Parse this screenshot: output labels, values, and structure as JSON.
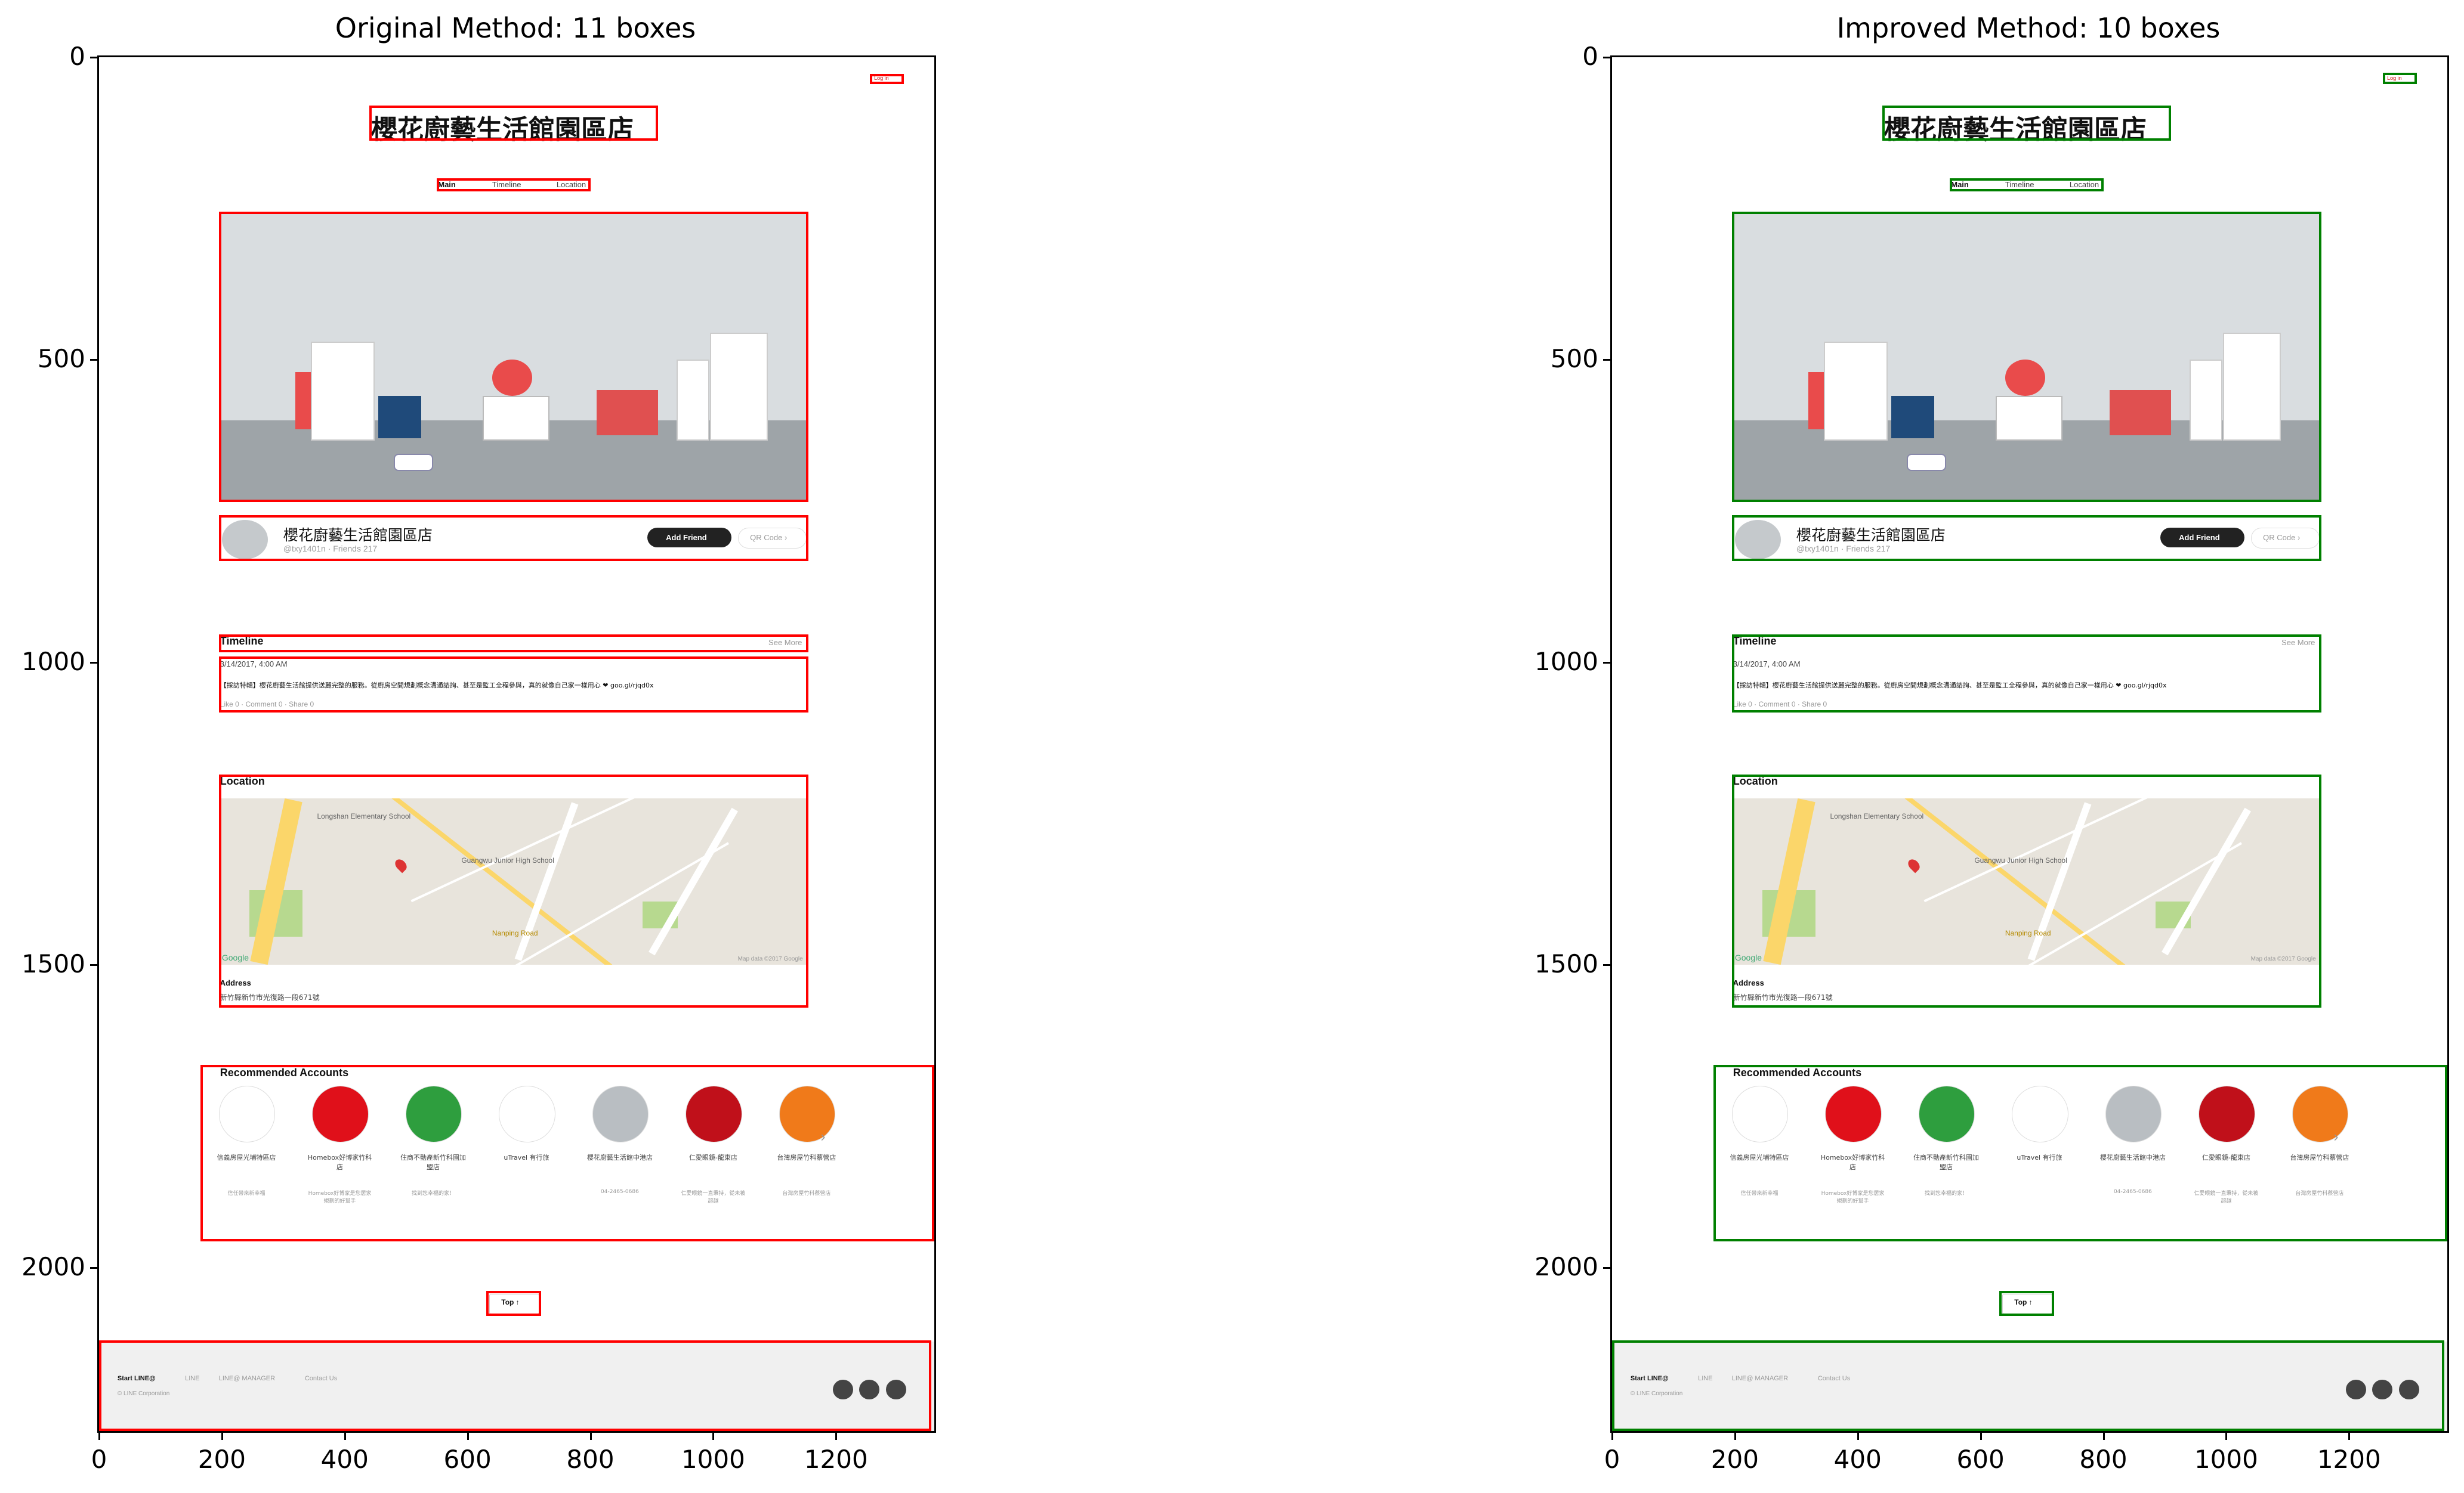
{
  "colors": {
    "original": "#ff0000",
    "improved": "#008000",
    "axis": "#000000"
  },
  "panels": [
    {
      "title": "Original Method: 11 boxes",
      "box_color": "red",
      "x_ticks": [
        "0",
        "200",
        "400",
        "600",
        "800",
        "1000",
        "1200"
      ],
      "y_ticks": [
        "0",
        "500",
        "1000",
        "1500",
        "2000"
      ]
    },
    {
      "title": "Improved Method: 10 boxes",
      "box_color": "green",
      "x_ticks": [
        "0",
        "200",
        "400",
        "600",
        "800",
        "1000",
        "1200"
      ],
      "y_ticks": [
        "0",
        "500",
        "1000",
        "1500",
        "2000"
      ]
    }
  ],
  "screenshot": {
    "login": "Log in",
    "page_title": "櫻花廚藝生活館園區店",
    "nav": [
      "Main",
      "Timeline",
      "Location"
    ],
    "account_name": "櫻花廚藝生活館園區店",
    "account_handle": "@txy1401n · Friends 217",
    "add_friend": "Add Friend",
    "qr_code": "QR Code ›",
    "timeline_heading": "Timeline",
    "see_more": "See More",
    "post_date": "3/14/2017, 4:00 AM",
    "post_text": "【採訪特輯】櫻花廚藝生活館提供送麗完整的服務。從廚房空間規劃概念溝通諮詢、甚至是監工全程參與，真的就像自己家一樣用心 ❤ goo.gl/rjqd0x",
    "post_stats": "Like 0 · Comment 0 · Share 0",
    "location_heading": "Location",
    "map_labels": [
      "Longshan Elementary School",
      "Guangwu Junior High School",
      "Nanping Road",
      "Google",
      "Map data ©2017 Google"
    ],
    "address_heading": "Address",
    "address": "新竹縣新竹市光復路一段671號",
    "recommended_heading": "Recommended Accounts",
    "recommended": [
      {
        "name": "信義房屋光埔特區店",
        "desc": "信任帶來新幸福"
      },
      {
        "name": "Homebox好博家竹科店",
        "desc": "Homebox好博家是您居家規劃的好幫手"
      },
      {
        "name": "住商不動產新竹科園加盟店",
        "desc": "找到您幸福的家！"
      },
      {
        "name": "uTravel 有行旅",
        "desc": ""
      },
      {
        "name": "櫻花廚藝生活館中港店",
        "desc": "04-2465-0686"
      },
      {
        "name": "仁愛眼鏡-龍東店",
        "desc": "仁愛眼鏡一直秉持，從未被超越"
      },
      {
        "name": "台灣房屋竹科蔡營店",
        "desc": "台灣房屋竹科蔡營店"
      }
    ],
    "top_button": "Top ↑",
    "footer_links": [
      "Start LINE@",
      "LINE",
      "LINE@ MANAGER",
      "Contact Us"
    ],
    "footer_copy": "© LINE Corporation"
  },
  "chart_data": [
    {
      "type": "image-with-boxes",
      "title": "Original Method: 11 boxes",
      "box_color": "red",
      "xlim": [
        0,
        1360
      ],
      "ylim": [
        2270,
        0
      ],
      "x_ticks": [
        0,
        200,
        400,
        600,
        800,
        1000,
        1200
      ],
      "y_ticks": [
        0,
        500,
        1000,
        1500,
        2000
      ],
      "boxes": [
        {
          "x0": 1255,
          "y0": 28,
          "x1": 1310,
          "y1": 44
        },
        {
          "x0": 440,
          "y0": 80,
          "x1": 910,
          "y1": 138
        },
        {
          "x0": 550,
          "y0": 200,
          "x1": 800,
          "y1": 222
        },
        {
          "x0": 195,
          "y0": 255,
          "x1": 1155,
          "y1": 735
        },
        {
          "x0": 195,
          "y0": 757,
          "x1": 1155,
          "y1": 833
        },
        {
          "x0": 195,
          "y0": 954,
          "x1": 1155,
          "y1": 983
        },
        {
          "x0": 195,
          "y0": 990,
          "x1": 1155,
          "y1": 1083
        },
        {
          "x0": 195,
          "y0": 1185,
          "x1": 1155,
          "y1": 1570
        },
        {
          "x0": 165,
          "y0": 1665,
          "x1": 1370,
          "y1": 1957
        },
        {
          "x0": 630,
          "y0": 2038,
          "x1": 720,
          "y1": 2080
        },
        {
          "x0": 0,
          "y0": 2120,
          "x1": 1355,
          "y1": 2270
        }
      ]
    },
    {
      "type": "image-with-boxes",
      "title": "Improved Method: 10 boxes",
      "box_color": "green",
      "xlim": [
        0,
        1360
      ],
      "ylim": [
        2270,
        0
      ],
      "x_ticks": [
        0,
        200,
        400,
        600,
        800,
        1000,
        1200
      ],
      "y_ticks": [
        0,
        500,
        1000,
        1500,
        2000
      ],
      "boxes": [
        {
          "x0": 1255,
          "y0": 26,
          "x1": 1310,
          "y1": 44
        },
        {
          "x0": 440,
          "y0": 80,
          "x1": 910,
          "y1": 138
        },
        {
          "x0": 550,
          "y0": 200,
          "x1": 800,
          "y1": 222
        },
        {
          "x0": 195,
          "y0": 255,
          "x1": 1155,
          "y1": 735
        },
        {
          "x0": 195,
          "y0": 757,
          "x1": 1155,
          "y1": 833
        },
        {
          "x0": 195,
          "y0": 954,
          "x1": 1155,
          "y1": 1083
        },
        {
          "x0": 195,
          "y0": 1185,
          "x1": 1155,
          "y1": 1570
        },
        {
          "x0": 165,
          "y0": 1665,
          "x1": 1370,
          "y1": 1957
        },
        {
          "x0": 630,
          "y0": 2038,
          "x1": 720,
          "y1": 2080
        },
        {
          "x0": 0,
          "y0": 2120,
          "x1": 1355,
          "y1": 2270
        }
      ]
    }
  ]
}
